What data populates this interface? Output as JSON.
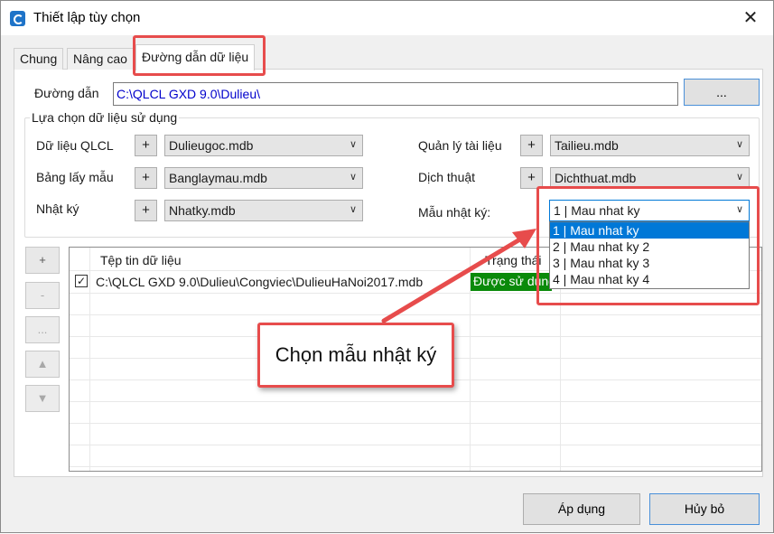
{
  "window": {
    "title": "Thiết lập tùy chọn",
    "close_glyph": "✕"
  },
  "tabs": [
    "Chung",
    "Nâng cao",
    "Đường dẫn dữ liệu"
  ],
  "path": {
    "label": "Đường dẫn",
    "value": "C:\\QLCL GXD 9.0\\Dulieu\\",
    "browse_label": "..."
  },
  "group": {
    "title": "Lựa chọn dữ liệu sử dụng",
    "left": [
      {
        "label": "Dữ liệu QLCL",
        "value": "Dulieugoc.mdb"
      },
      {
        "label": "Bảng lấy mẫu",
        "value": "Banglaymau.mdb"
      },
      {
        "label": "Nhật ký",
        "value": "Nhatky.mdb"
      }
    ],
    "right": [
      {
        "label": "Quản lý tài liệu",
        "value": "Tailieu.mdb"
      },
      {
        "label": "Dịch thuật",
        "value": "Dichthuat.mdb"
      },
      {
        "label": "Mẫu nhật ký:",
        "value": "1 | Mau nhat ky"
      }
    ],
    "plus_label": "+"
  },
  "dropdown_options": [
    "1 | Mau nhat ky",
    "2 | Mau nhat ky 2",
    "3 | Mau nhat ky 3",
    "4 | Mau nhat ky 4"
  ],
  "side_buttons": [
    "+",
    "-",
    "...",
    "▲",
    "▼"
  ],
  "grid": {
    "headers": [
      "Tệp tin dữ liệu",
      "Trạng thái"
    ],
    "rows": [
      {
        "file": "C:\\QLCL GXD 9.0\\Dulieu\\Congviec\\DulieuHaNoi2017.mdb",
        "status": "Được sử dụng",
        "checked": "✓"
      }
    ]
  },
  "footer": {
    "apply_label": "Áp dụng",
    "cancel_label": "Hủy bỏ"
  },
  "callout": {
    "text": "Chọn mẫu nhật ký"
  },
  "colors": {
    "accent": "#0078d7",
    "highlight": "#e74c4c",
    "status_green": "#0a8a0a",
    "path_text": "#0000cc"
  }
}
